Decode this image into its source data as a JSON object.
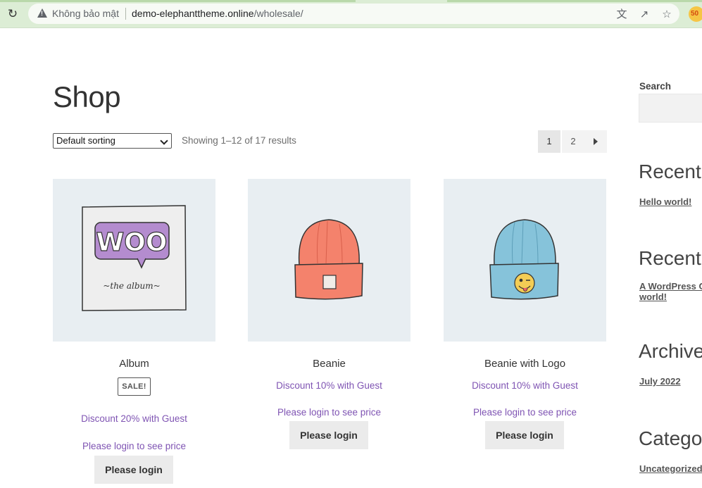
{
  "browser": {
    "security_label": "Không bảo mật",
    "url_host": "demo-elephanttheme.online",
    "url_path": "/wholesale/",
    "extension_badge": "50"
  },
  "shop": {
    "title": "Shop",
    "sorting_selected": "Default sorting",
    "result_count": "Showing 1–12 of 17 results",
    "pagination": [
      "1",
      "2"
    ],
    "current_page": "1"
  },
  "products": [
    {
      "name": "Album",
      "badge": "SALE!",
      "discount": "Discount 20% with Guest",
      "login_msg": "Please login to see price",
      "button": "Please login",
      "image_text": "WOO",
      "image_subtext": "~the   album~"
    },
    {
      "name": "Beanie",
      "discount": "Discount 10% with Guest",
      "login_msg": "Please login to see price",
      "button": "Please login"
    },
    {
      "name": "Beanie with Logo",
      "discount": "Discount 10% with Guest",
      "login_msg": "Please login to see price",
      "button": "Please login"
    }
  ],
  "sidebar": {
    "search_label": "Search",
    "recent_posts_heading": "Recent P",
    "recent_post_link": "Hello world!",
    "recent_comments_heading": "Recent C",
    "recent_comment_line1": "A WordPress Co",
    "recent_comment_line2": "world!",
    "archives_heading": "Archives",
    "archive_link": "July 2022",
    "categories_heading": "Categor",
    "category_link": "Uncategorized"
  },
  "colors": {
    "accent_purple": "#7f54b3",
    "chrome_green": "#dcedd5",
    "thumb_bg": "#e8eef2"
  }
}
